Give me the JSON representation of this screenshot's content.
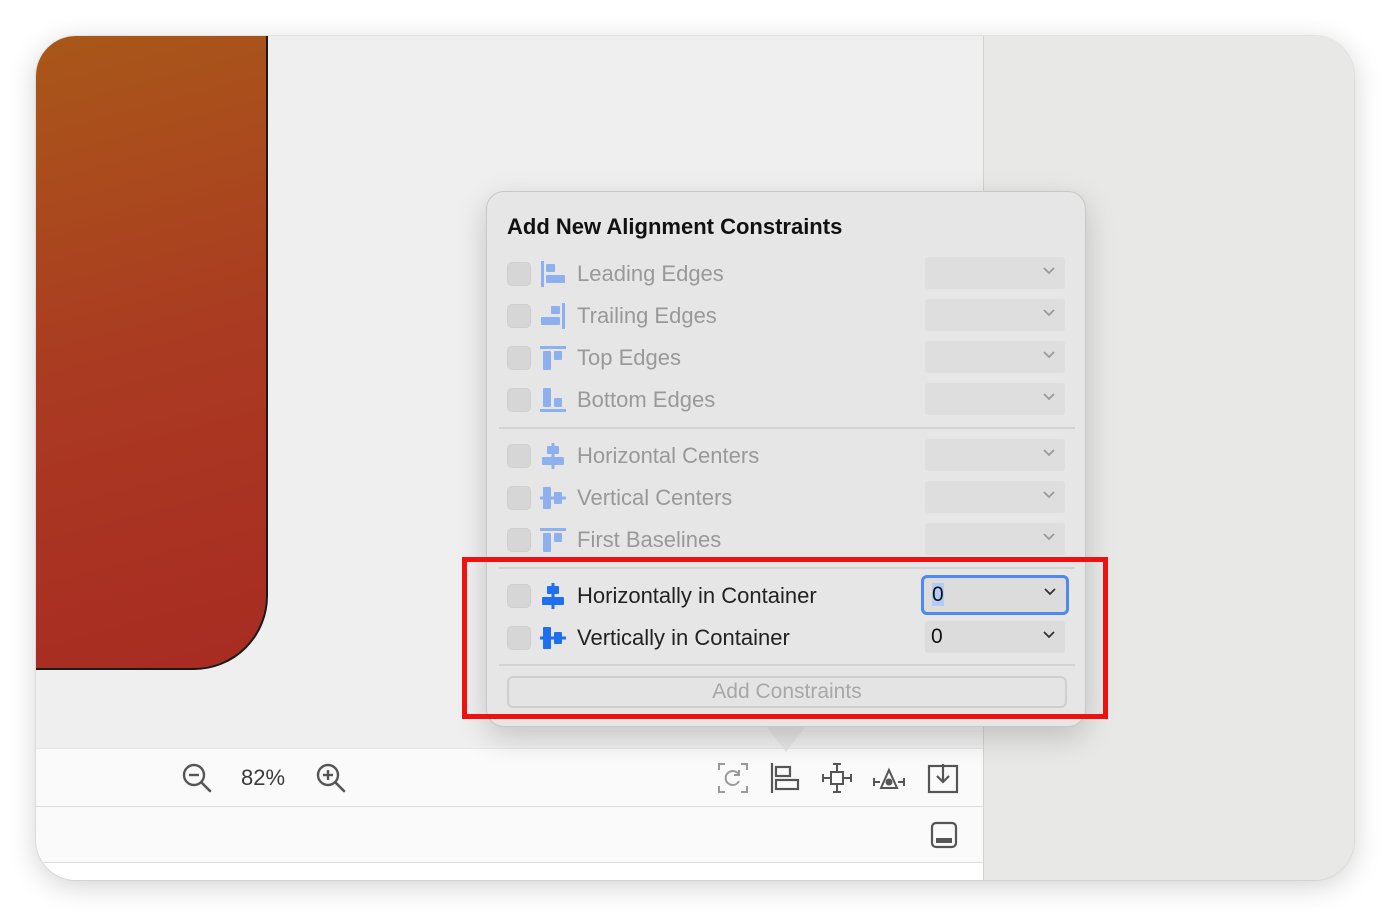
{
  "canvas": {
    "zoom": "82%"
  },
  "popover": {
    "title": "Add New Alignment Constraints",
    "rows": [
      {
        "label": "Leading Edges",
        "value": "",
        "enabled": false
      },
      {
        "label": "Trailing Edges",
        "value": "",
        "enabled": false
      },
      {
        "label": "Top Edges",
        "value": "",
        "enabled": false
      },
      {
        "label": "Bottom Edges",
        "value": "",
        "enabled": false
      },
      {
        "label": "Horizontal Centers",
        "value": "",
        "enabled": false
      },
      {
        "label": "Vertical Centers",
        "value": "",
        "enabled": false
      },
      {
        "label": "First Baselines",
        "value": "",
        "enabled": false
      },
      {
        "label": "Horizontally in Container",
        "value": "0",
        "enabled": true
      },
      {
        "label": "Vertically in Container",
        "value": "0",
        "enabled": true
      }
    ],
    "add_button": "Add Constraints"
  },
  "colors": {
    "accent": "#1f6ff0",
    "disabled_icon": "#8fb0ef",
    "highlight": "#ee1111"
  },
  "icons": [
    "leading-edges-icon",
    "trailing-edges-icon",
    "top-edges-icon",
    "bottom-edges-icon",
    "horizontal-centers-icon",
    "vertical-centers-icon",
    "first-baselines-icon",
    "zoom-out-icon",
    "zoom-in-icon",
    "update-frames-icon",
    "align-icon",
    "add-constraints-icon",
    "resolve-issues-icon",
    "embed-in-icon",
    "debug-area-icon"
  ]
}
